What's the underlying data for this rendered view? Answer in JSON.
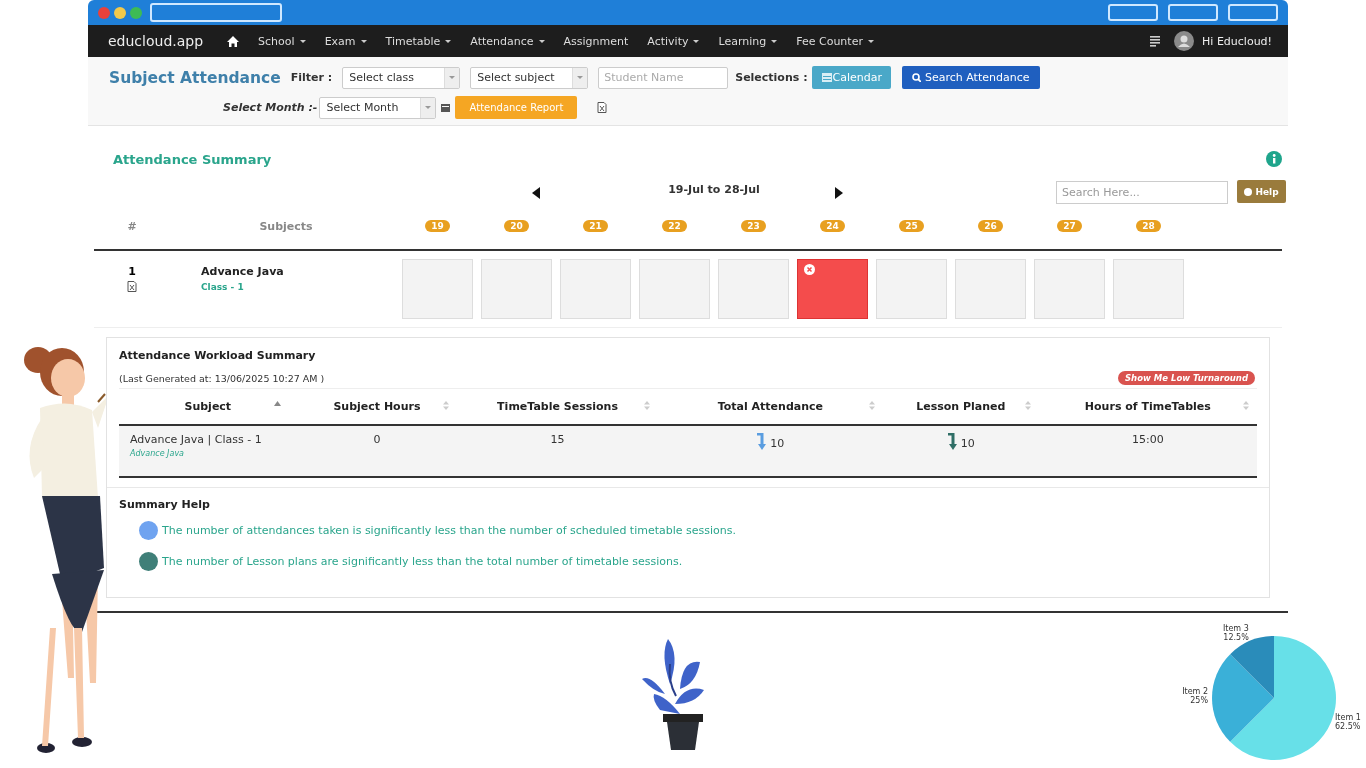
{
  "nav": {
    "brand": "educloud.app",
    "items": [
      {
        "label": "School",
        "dropdown": true
      },
      {
        "label": "Exam",
        "dropdown": true
      },
      {
        "label": "Timetable",
        "dropdown": true
      },
      {
        "label": "Attendance",
        "dropdown": true
      },
      {
        "label": "Assignment",
        "dropdown": false
      },
      {
        "label": "Activity",
        "dropdown": true
      },
      {
        "label": "Learning",
        "dropdown": true
      },
      {
        "label": "Fee Counter",
        "dropdown": true
      }
    ],
    "user": "Hi Educloud!"
  },
  "toolbar": {
    "title": "Subject Attendance",
    "filter_label": "Filter :",
    "class_select": {
      "value": "Select class"
    },
    "subject_select": {
      "value": "Select subject"
    },
    "student_field": {
      "placeholder": "Student Name"
    },
    "selections_label": "Selections :",
    "calendar_button": "Calendar",
    "search_button": "Search Attendance",
    "month_label": "Select Month :-",
    "month_select": {
      "value": "Select Month"
    },
    "report_button": "Attendance Report"
  },
  "summary": {
    "title": "Attendance Summary",
    "range": "19-Jul to 28-Jul",
    "search": {
      "placeholder": "Search Here..."
    },
    "help_button": "Help",
    "columns": [
      "#",
      "Subjects"
    ],
    "days": [
      "19",
      "20",
      "21",
      "22",
      "23",
      "24",
      "25",
      "26",
      "27",
      "28"
    ],
    "rows": [
      {
        "number": "1",
        "subject": "Advance Java",
        "class": "Class - 1",
        "cells": [
          {
            "kind": "empty"
          },
          {
            "kind": "empty"
          },
          {
            "kind": "empty"
          },
          {
            "kind": "empty"
          },
          {
            "kind": "empty"
          },
          {
            "kind": "absent"
          },
          {
            "kind": "empty"
          },
          {
            "kind": "empty"
          },
          {
            "kind": "empty"
          },
          {
            "kind": "empty"
          }
        ]
      }
    ]
  },
  "workload": {
    "title": "Attendance Workload Summary",
    "generated": "(Last Generated at: 13/06/2025 10:27 AM )",
    "low_button": "Show Me Low Turnaround",
    "columns": [
      {
        "label": "Subject",
        "sorted": true
      },
      {
        "label": "Subject Hours",
        "sorted": false
      },
      {
        "label": "TimeTable Sessions",
        "sorted": false
      },
      {
        "label": "Total Attendance",
        "sorted": false
      },
      {
        "label": "Lesson Planed",
        "sorted": false
      },
      {
        "label": "Hours of TimeTables",
        "sorted": false
      }
    ],
    "rows": [
      {
        "subject": "Advance Java | Class - 1",
        "sub": "Advance Java",
        "hours": "0",
        "sessions": "15",
        "attendance": "10",
        "lessons": "10",
        "timetable_hours": "15:00"
      }
    ]
  },
  "help": {
    "title": "Summary Help",
    "items": [
      {
        "text": "The number of attendances taken is significantly less than the number of scheduled timetable sessions.",
        "color": "#6fa3f0"
      },
      {
        "text": "The number of Lesson plans are significantly less than the total number of timetable sessions.",
        "color": "#3f7f78"
      }
    ]
  },
  "chart": {
    "chart_data": {
      "type": "pie",
      "categories": [
        "Item 1",
        "Item 2",
        "Item 3"
      ],
      "values": [
        62.5,
        25,
        12.5
      ],
      "value_labels": [
        "62.5%",
        "25%",
        "12.5%"
      ]
    }
  }
}
